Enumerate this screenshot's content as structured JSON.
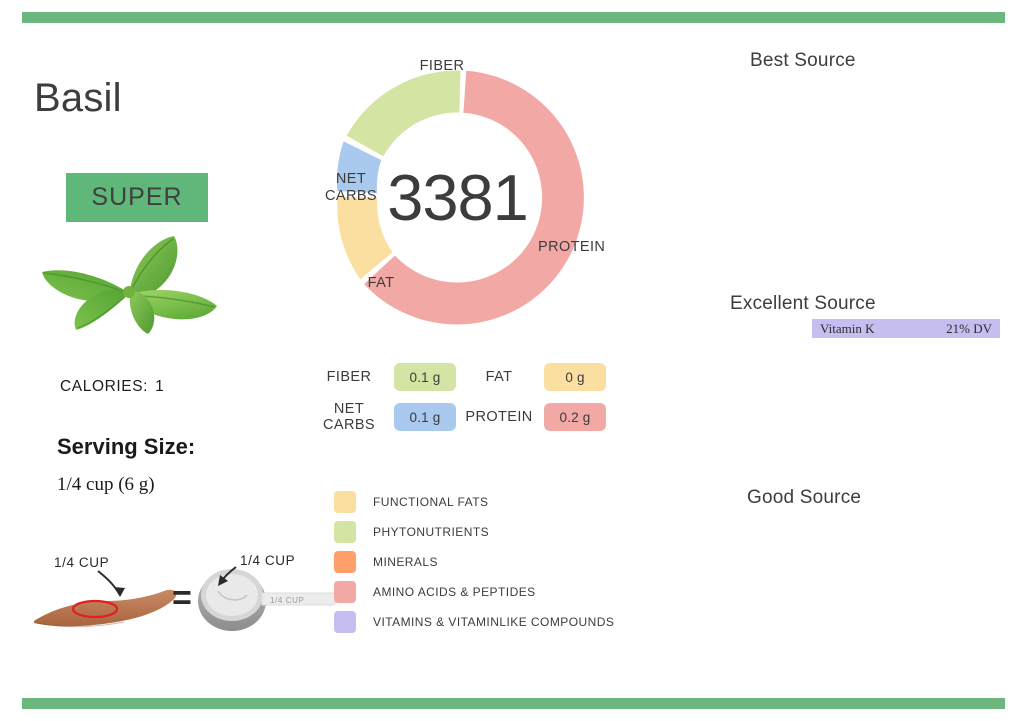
{
  "theme": {
    "rule_color": "#6cb67f",
    "badge_color": "#5fb87a",
    "text_color": "#3c3c3c"
  },
  "food": {
    "name": "Basil",
    "badge": "SUPER",
    "image_alt": "basil-leaves"
  },
  "facts": {
    "calories_label": "CALORIES:",
    "calories_value": "1",
    "serving_size_label": "Serving Size:",
    "serving_size_value": "1/4 cup (6 g)"
  },
  "equivalence": {
    "hand_label": "1/4 CUP",
    "equals": "=",
    "cup_label": "1/4 CUP",
    "cup_body_text": "1/4  CUP"
  },
  "chart_data": {
    "type": "pie",
    "title": "",
    "center_value": "3381",
    "legend_position": "none",
    "categories": [
      "FIBER",
      "NET CARBS",
      "FAT",
      "PROTEIN"
    ],
    "values": [
      22,
      12,
      9,
      57
    ],
    "unit": "% of macronutrient distribution",
    "colors": [
      "#d3e4a3",
      "#a9c9ef",
      "#fadfa0",
      "#f2a9a6"
    ],
    "labels": [
      "FIBER",
      "NET\nCARBS",
      "FAT",
      "PROTEIN"
    ]
  },
  "macros": {
    "rows": [
      [
        {
          "name": "FIBER",
          "value": "0.1 g",
          "color": "#d3e4a3"
        },
        {
          "name": "FAT",
          "value": "0 g",
          "color": "#fadfa0"
        }
      ],
      [
        {
          "name": "NET\nCARBS",
          "value": "0.1 g",
          "color": "#a9c9ef"
        },
        {
          "name": "PROTEIN",
          "value": "0.2 g",
          "color": "#f2a9a6"
        }
      ]
    ]
  },
  "legend": {
    "items": [
      {
        "label": "FUNCTIONAL  FATS",
        "color": "#fadfa0"
      },
      {
        "label": "PHYTONUTRIENTS",
        "color": "#d3e4a3"
      },
      {
        "label": "MINERALS",
        "color": "#ffa06b"
      },
      {
        "label": "AMINO ACIDS & PEPTIDES",
        "color": "#f2a9a6"
      },
      {
        "label": "VITAMINS & VITAMINLIKE COMPOUNDS",
        "color": "#c6bdf0"
      }
    ]
  },
  "sources": {
    "best": {
      "heading": "Best Source",
      "items": []
    },
    "excellent": {
      "heading": "Excellent Source",
      "items": [
        {
          "nutrient": "Vitamin K",
          "dv": "21% DV",
          "color": "#c6bdf0"
        }
      ]
    },
    "good": {
      "heading": "Good Source",
      "items": []
    }
  }
}
